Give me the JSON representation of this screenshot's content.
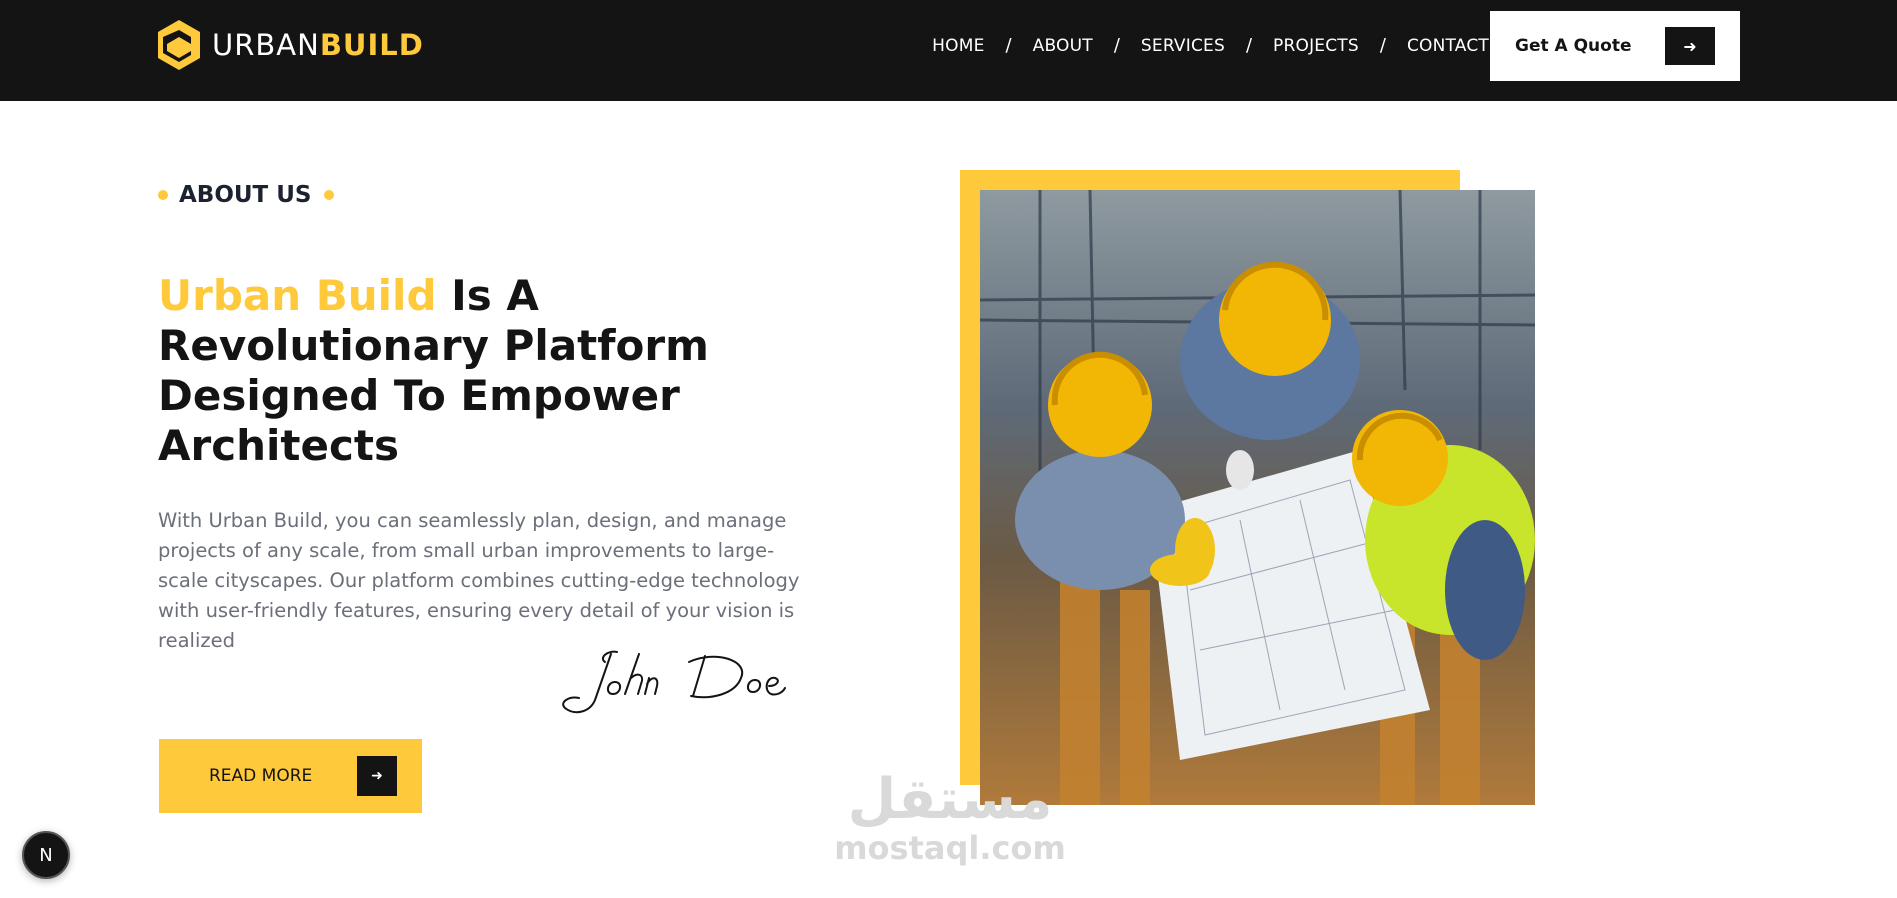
{
  "brand": {
    "urban": "URBAN",
    "build": "BUILD"
  },
  "nav": {
    "items": [
      "HOME",
      "ABOUT",
      "SERVICES",
      "PROJECTS",
      "CONTACT"
    ],
    "separator": "/"
  },
  "header": {
    "quote_label": "Get A Quote",
    "quote_icon": "arrow-right-icon"
  },
  "about": {
    "eyebrow": "ABOUT US",
    "headline_accent": "Urban Build",
    "headline_rest_1": " Is A",
    "headline_rest_2": "Revolutionary Platform",
    "headline_rest_3": "Designed To Empower",
    "headline_rest_4": "Architects",
    "body": "With Urban Build, you can seamlessly plan, design, and manage projects of any scale, from small urban improvements to large-scale cityscapes. Our platform combines cutting-edge technology with user-friendly features, ensuring every detail of your vision is realized",
    "signature": "John Doe",
    "read_more_label": "READ MORE",
    "read_more_icon": "arrow-right-icon"
  },
  "watermark": {
    "arabic": "مستقل",
    "latin": "mostaql.com"
  },
  "badge": {
    "letter": "N"
  },
  "colors": {
    "accent": "#ffc93c",
    "dark": "#141414",
    "muted": "#6b6f7a"
  }
}
